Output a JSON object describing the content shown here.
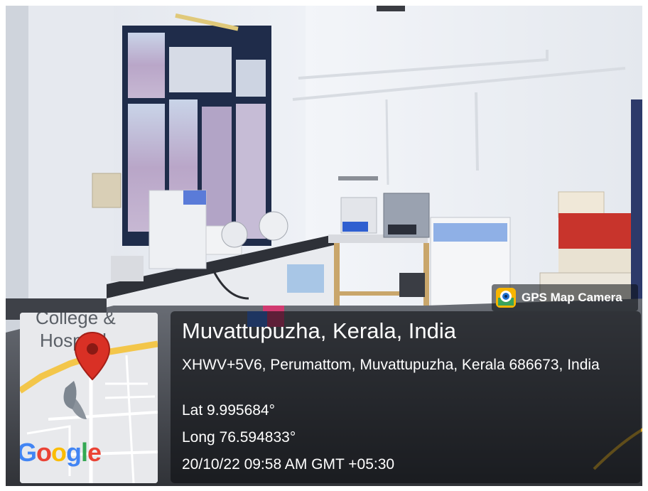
{
  "photo": {
    "description_icon": "lab-room-photo"
  },
  "map": {
    "place_line1": "College &",
    "place_line2": "Hospital",
    "pin_icon": "map-pin-icon",
    "logo": {
      "g1": "G",
      "o1": "o",
      "o2": "o",
      "g2": "g",
      "l": "l",
      "e": "e"
    }
  },
  "badge": {
    "label": "GPS Map Camera",
    "icon": "gps-camera-icon"
  },
  "location": {
    "title": "Muvattupuzha, Kerala, India",
    "address": "XHWV+5V6, Perumattom, Muvattupuzha, Kerala 686673, India",
    "lat": "Lat 9.995684°",
    "long": "Long 76.594833°",
    "timestamp": "20/10/22 09:58 AM GMT +05:30"
  },
  "colors": {
    "pin": "#d93025",
    "map_road": "#f6c542",
    "panel": "#0a0c10"
  }
}
